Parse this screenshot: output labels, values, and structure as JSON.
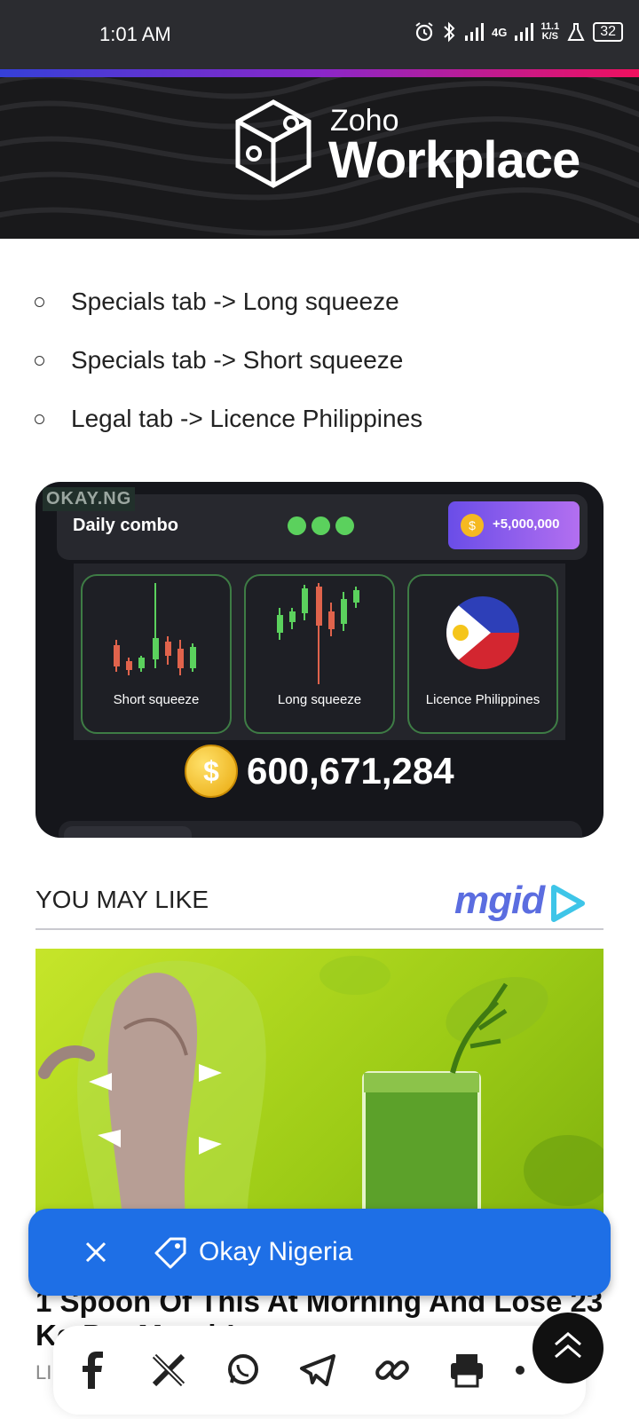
{
  "status_bar": {
    "time": "1:01 AM",
    "net_speed_top": "11.1",
    "net_speed_bottom": "K/S",
    "network": "4G",
    "battery": "32"
  },
  "banner": {
    "brand_small": "Zoho",
    "brand_big": "Workplace"
  },
  "steps": [
    "Specials tab -> Long squeeze",
    "Specials tab -> Short squeeze",
    "Legal tab -> Licence Philippines"
  ],
  "combo": {
    "watermark": "OKAY.NG",
    "title": "Daily combo",
    "reward": "+5,000,000",
    "cards": [
      "Short squeeze",
      "Long squeeze",
      "Licence Philippines"
    ],
    "balance": "600,671,284",
    "coin_symbol": "$"
  },
  "recommend": {
    "heading": "YOU MAY LIKE",
    "provider": "mgid",
    "ad_title": "1 Spoon Of This At Morning And Lose 23 Kg Per Month!",
    "ad_source": "LII"
  },
  "toast": {
    "label": "Okay Nigeria"
  },
  "share_bar": {
    "icons": [
      "facebook-icon",
      "x-icon",
      "whatsapp-icon",
      "telegram-icon",
      "link-icon",
      "print-icon"
    ]
  },
  "colors": {
    "accent_blue": "#1e6fe6",
    "combo_green": "#5bd15d",
    "reward_purple": "#8a5cf0"
  }
}
